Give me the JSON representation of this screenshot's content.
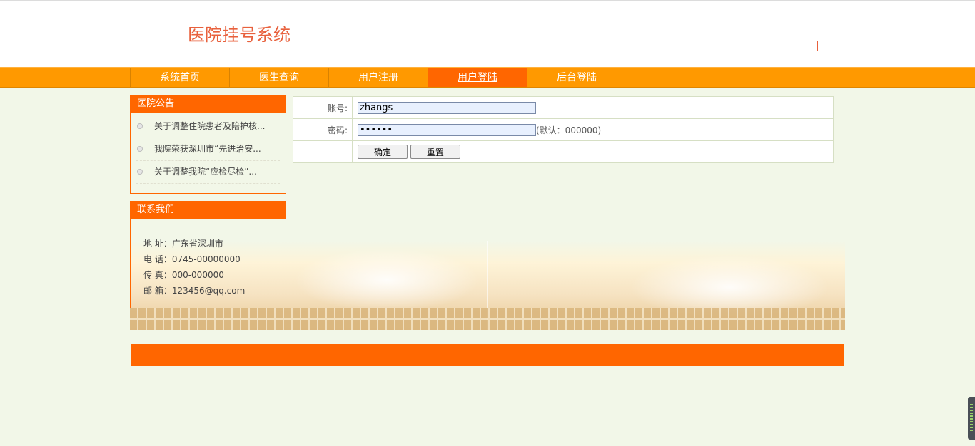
{
  "site": {
    "title": "医院挂号系统"
  },
  "nav": {
    "items": [
      {
        "label": "系统首页"
      },
      {
        "label": "医生查询"
      },
      {
        "label": "用户注册"
      },
      {
        "label": "用户登陆"
      },
      {
        "label": "后台登陆"
      }
    ],
    "active_index": 3
  },
  "notice": {
    "title": "医院公告",
    "items": [
      {
        "text": "关于调整住院患者及陪护核..."
      },
      {
        "text": "我院荣获深圳市“先进治安..."
      },
      {
        "text": "关于调整我院“应检尽检”..."
      }
    ]
  },
  "contact": {
    "title": "联系我们",
    "lines": [
      {
        "text": "地 址：广东省深圳市"
      },
      {
        "text": "电 话：0745-00000000"
      },
      {
        "text": "传 真：000-000000"
      },
      {
        "text": "邮 箱：123456@qq.com"
      }
    ]
  },
  "login": {
    "account_label": "账号:",
    "account_value": "zhangs",
    "password_label": "密码:",
    "password_value": "000000",
    "password_hint": "(默认：000000)",
    "confirm_label": "确定",
    "reset_label": "重置"
  },
  "colors": {
    "accent": "#ff6600",
    "nav": "#ff9900",
    "title": "#e8603c",
    "background": "#f2f7e8"
  }
}
